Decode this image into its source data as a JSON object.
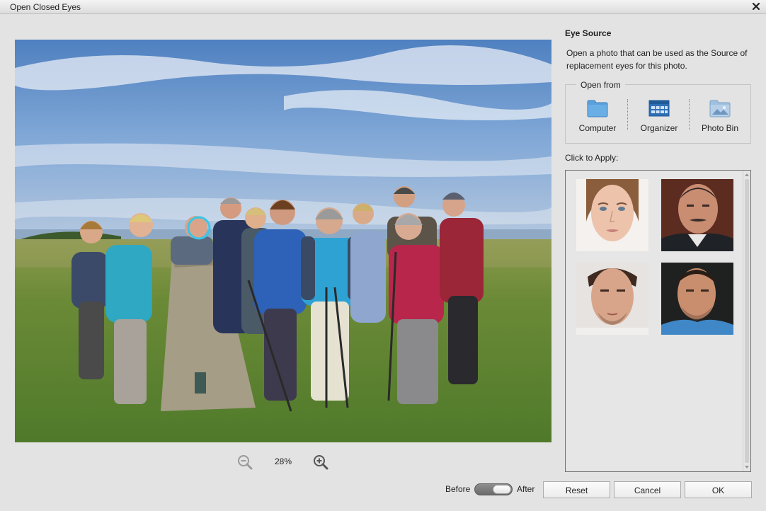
{
  "window": {
    "title": "Open Closed Eyes",
    "close_icon": "close-icon"
  },
  "preview": {
    "zoom": "28%",
    "zoom_out_icon": "zoom-out-icon",
    "zoom_in_icon": "zoom-in-icon"
  },
  "eye_source": {
    "title": "Eye Source",
    "description": "Open a photo that can be used as the Source of replacement eyes for this photo.",
    "open_from": {
      "legend": "Open from",
      "sources": [
        {
          "label": "Computer",
          "icon": "folder-icon"
        },
        {
          "label": "Organizer",
          "icon": "organizer-grid-icon"
        },
        {
          "label": "Photo Bin",
          "icon": "photo-bin-icon"
        }
      ]
    },
    "apply_label": "Click to Apply:"
  },
  "footer": {
    "before_label": "Before",
    "after_label": "After",
    "toggle_state": "after",
    "reset_label": "Reset",
    "cancel_label": "Cancel",
    "ok_label": "OK"
  },
  "colors": {
    "background": "#e3e3e3",
    "accent_ring": "#39c6e8",
    "folder_blue": "#5aa0dd"
  }
}
